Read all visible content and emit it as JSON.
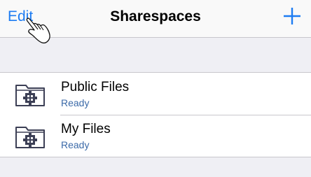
{
  "navbar": {
    "edit_label": "Edit",
    "title": "Sharespaces",
    "add_icon": "plus-icon"
  },
  "colors": {
    "accent": "#1d7cf2",
    "status": "#3b6aa8",
    "background": "#efeff4"
  },
  "items": [
    {
      "title": "Public Files",
      "status": "Ready",
      "icon": "shared-folder-icon"
    },
    {
      "title": "My Files",
      "status": "Ready",
      "icon": "shared-folder-icon"
    }
  ]
}
